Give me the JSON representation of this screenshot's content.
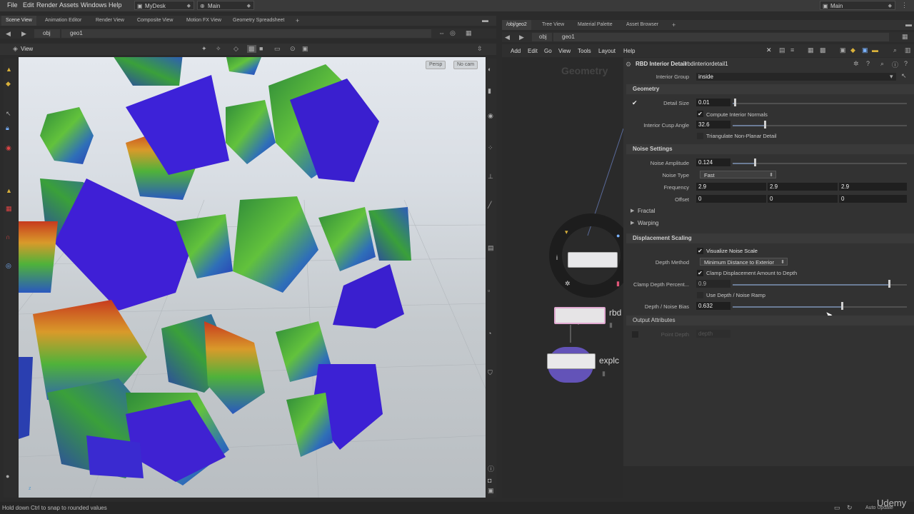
{
  "menu": {
    "items": [
      "File",
      "Edit",
      "Render",
      "Assets",
      "Windows",
      "Help"
    ],
    "desktop": "MyDesk",
    "context": "Main",
    "context_right": "Main"
  },
  "left_tabs": [
    "Scene View",
    "Animation Editor",
    "Render View",
    "Composite View",
    "Motion FX View",
    "Geometry Spreadsheet"
  ],
  "left_path": {
    "obj": "obj",
    "geo": "geo1"
  },
  "viewport": {
    "label": "View",
    "persp": "Persp",
    "cam": "No cam"
  },
  "right_tabs": [
    "/obj/geo2",
    "Tree View",
    "Material Palette",
    "Asset Browser"
  ],
  "right_path": {
    "obj": "obj",
    "geo": "geo1"
  },
  "network_menu": [
    "Add",
    "Edit",
    "Go",
    "View",
    "Tools",
    "Layout",
    "Help"
  ],
  "network": {
    "watermark": "Geometry",
    "node1_label": "rbd",
    "node2_label": "explc"
  },
  "params": {
    "node_type": "RBD Interior Detail",
    "node_name": "rbdinteriordetail1",
    "interior_group_label": "Interior Group",
    "interior_group_value": "inside",
    "geometry_section": "Geometry",
    "detail_size_label": "Detail Size",
    "detail_size_value": "0.01",
    "compute_normals_label": "Compute Interior Normals",
    "cusp_angle_label": "Interior Cusp Angle",
    "cusp_angle_value": "32.6",
    "triangulate_label": "Triangulate Non-Planar Detail",
    "noise_section": "Noise Settings",
    "noise_amp_label": "Noise Amplitude",
    "noise_amp_value": "0.124",
    "noise_type_label": "Noise Type",
    "noise_type_value": "Fast",
    "frequency_label": "Frequency",
    "frequency": [
      "2.9",
      "2.9",
      "2.9"
    ],
    "offset_label": "Offset",
    "offset": [
      "0",
      "0",
      "0"
    ],
    "fractal_label": "Fractal",
    "warping_label": "Warping",
    "disp_section": "Displacement Scaling",
    "visualize_label": "Visualize Noise Scale",
    "depth_method_label": "Depth Method",
    "depth_method_value": "Minimum Distance to Exterior",
    "clamp_label": "Clamp Displacement Amount to Depth",
    "clamp_pct_label": "Clamp Depth Percent...",
    "clamp_pct_value": "0.9",
    "ramp_label": "Use Depth / Noise Ramp",
    "bias_label": "Depth / Noise Bias",
    "bias_value": "0.632",
    "output_section": "Output Attributes",
    "point_depth_label": "Point Depth",
    "point_depth_value": "depth"
  },
  "status": {
    "hint": "Hold down Ctrl to snap to rounded values",
    "auto_update": "Auto Update",
    "watermark": "Udemy"
  },
  "colors": {
    "accent": "#6b7c96",
    "purple": "#3a1fcf",
    "green": "#3aa32f"
  }
}
